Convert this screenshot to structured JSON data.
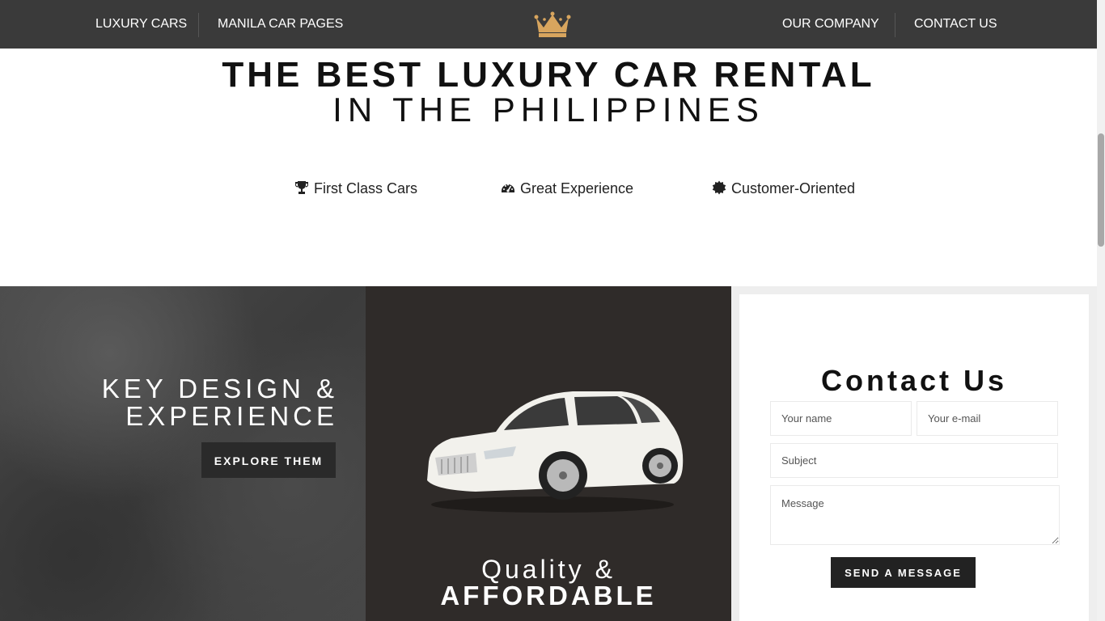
{
  "nav": {
    "left": [
      "LUXURY CARS",
      "MANILA CAR PAGES"
    ],
    "right": [
      "OUR COMPANY",
      "CONTACT US"
    ],
    "logo_icon": "crown-icon",
    "logo_color": "#d8a55e"
  },
  "hero": {
    "line1": "THE BEST LUXURY CAR RENTAL",
    "line2": "IN THE PHILIPPINES"
  },
  "features": [
    {
      "icon": "trophy-icon",
      "label": "First Class Cars"
    },
    {
      "icon": "tachometer-icon",
      "label": "Great Experience"
    },
    {
      "icon": "certificate-icon",
      "label": "Customer-Oriented"
    }
  ],
  "design_panel": {
    "line1": "KEY DESIGN &",
    "line2": "EXPERIENCE",
    "button": "EXPLORE THEM"
  },
  "quality_panel": {
    "line1": "Quality &",
    "line2": "AFFORDABLE",
    "image": "white-luxury-sedan"
  },
  "contact": {
    "title": "Contact Us",
    "name_placeholder": "Your name",
    "email_placeholder": "Your e-mail",
    "subject_placeholder": "Subject",
    "message_placeholder": "Message",
    "button": "SEND A MESSAGE"
  }
}
